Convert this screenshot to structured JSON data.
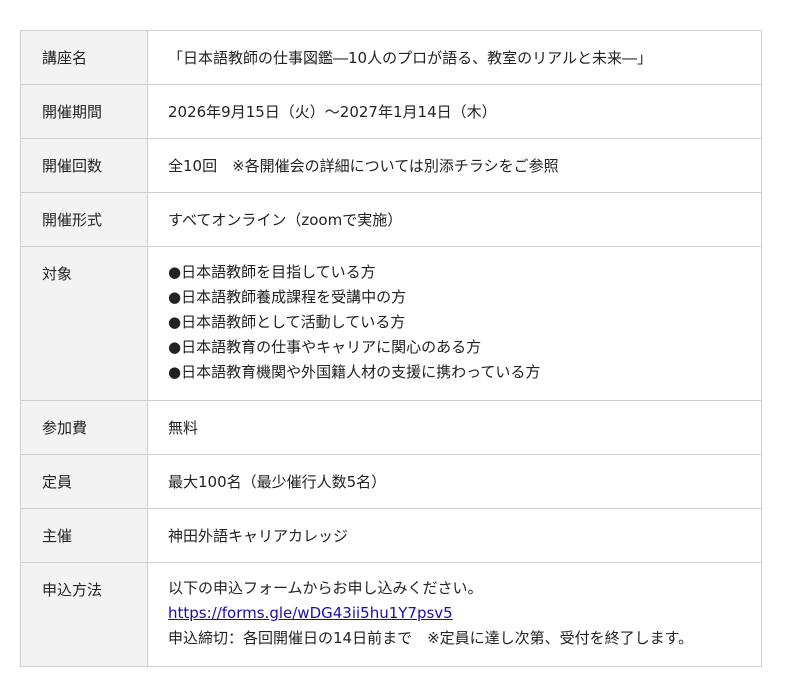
{
  "rows": [
    {
      "label": "講座名",
      "value": "「日本語教師の仕事図鑑―10人のプロが語る、教室のリアルと未来―」"
    },
    {
      "label": "開催期間",
      "value": "2026年9月15日（火）～2027年1月14日（木）"
    },
    {
      "label": "開催回数",
      "value": "全10回　※各開催会の詳細については別添チラシをご参照"
    },
    {
      "label": "開催形式",
      "value": "すべてオンライン（zoomで実施）"
    }
  ],
  "target": {
    "label": "対象",
    "items": [
      "●日本語教師を目指している方",
      "●日本語教師養成課程を受講中の方",
      "●日本語教師として活動している方",
      "●日本語教育の仕事やキャリアに関心のある方",
      "●日本語教育機関や外国籍人材の支援に携わっている方"
    ]
  },
  "rows2": [
    {
      "label": "参加費",
      "value": "無料"
    },
    {
      "label": "定員",
      "value": "最大100名（最少催行人数5名）"
    },
    {
      "label": "主催",
      "value": "神田外語キャリアカレッジ"
    }
  ],
  "apply": {
    "label": "申込方法",
    "line1": "以下の申込フォームからお申し込みください。",
    "link": "https://forms.gle/wDG43ii5hu1Y7psv5",
    "line3": "申込締切：各回開催日の14日前まで　※定員に達し次第、受付を終了します。"
  }
}
